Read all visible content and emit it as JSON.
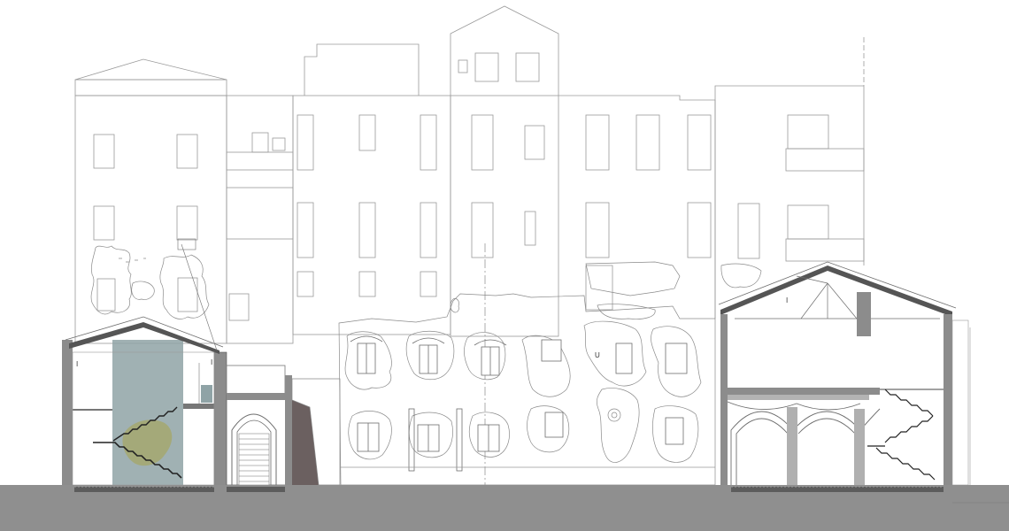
{
  "drawing": {
    "type": "architectural section elevation",
    "labels": {
      "left_section_mark": "I",
      "left_section_mark_2": "I",
      "right_section_mark": "I",
      "center_facade_mark": "U"
    },
    "colors": {
      "line": "#6e6e6e",
      "light_line": "#9a9a9a",
      "ground": "#8f8f8f",
      "cut_wall": "#8c8c8c",
      "glass": "#8fa3a6",
      "olive": "#a5a86a",
      "dark_cut": "#6b6060"
    }
  }
}
